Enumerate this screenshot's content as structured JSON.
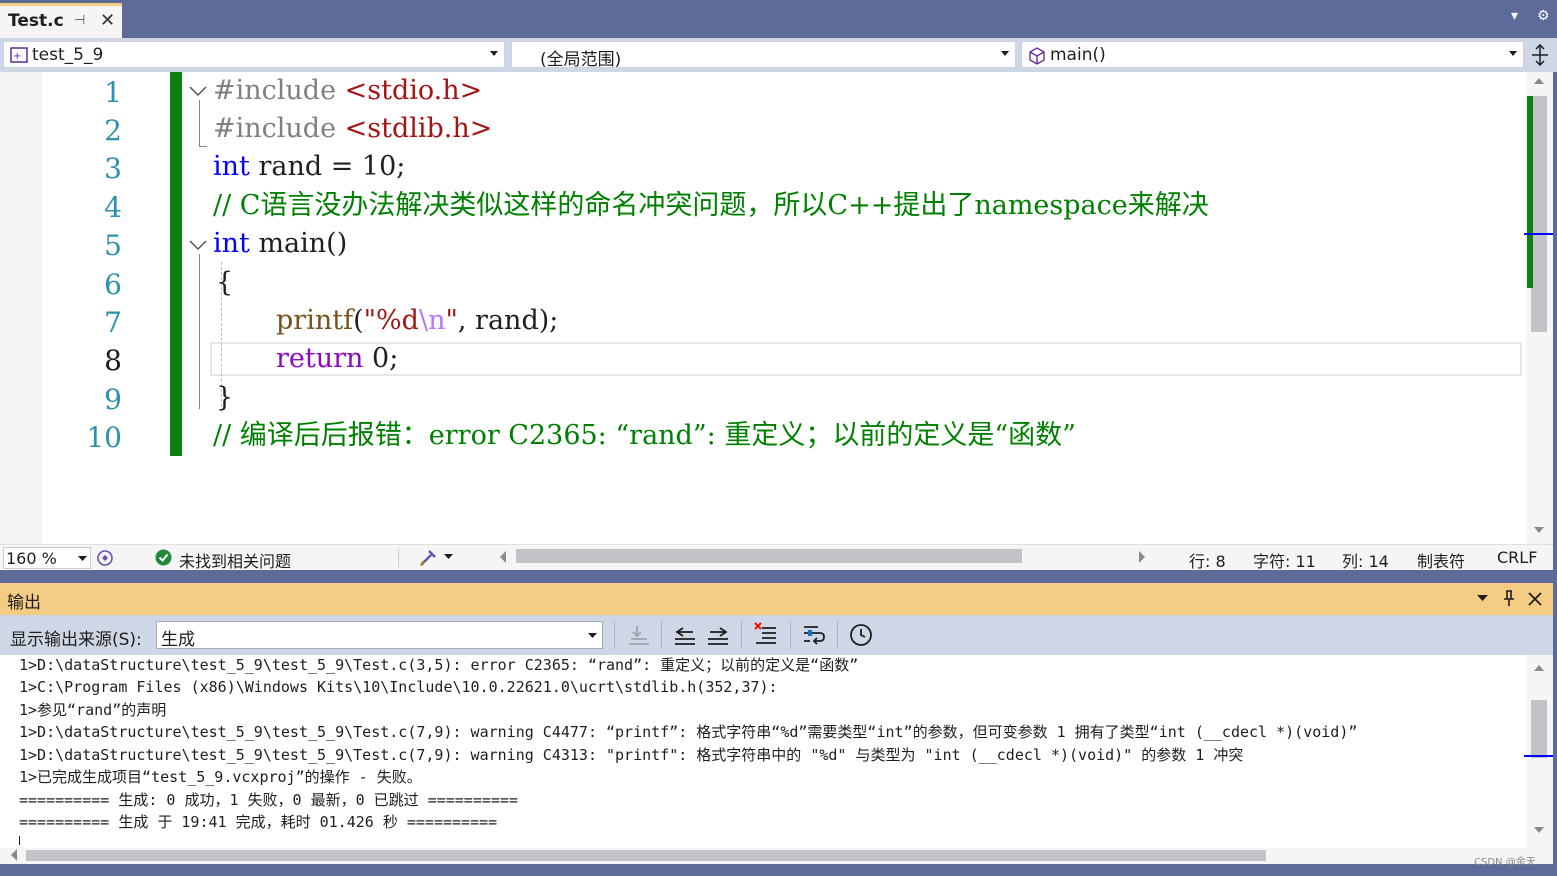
{
  "tab": {
    "name": "Test.c",
    "pin": "⊣",
    "close": "✕"
  },
  "window_icons": {
    "dropdown": "▾",
    "settings": "⚙"
  },
  "navbar": {
    "project": "test_5_9",
    "scope": "(全局范围)",
    "member": "main()"
  },
  "editor": {
    "line_numbers": [
      "1",
      "2",
      "3",
      "4",
      "5",
      "6",
      "7",
      "8",
      "9",
      "10"
    ],
    "current_line": 8,
    "lines": {
      "l1": {
        "pp": "#include ",
        "inc": "<stdio.h>"
      },
      "l2": {
        "pp": "#include ",
        "inc": "<stdlib.h>"
      },
      "l3": {
        "kw": "int",
        "rest": " rand = 10;"
      },
      "l4": {
        "comment": "// C语言没办法解决类似这样的命名冲突问题，所以C++提出了namespace来解决"
      },
      "l5": {
        "kw": "int",
        "rest": " main()"
      },
      "l6": {
        "text": "{"
      },
      "l7": {
        "fn": "printf",
        "open": "(",
        "str1": "\"%d",
        "esc": "\\n",
        "str2": "\"",
        "rest": ", rand);"
      },
      "l8": {
        "ctl": "return",
        "num": " 0",
        "rest": ";"
      },
      "l9": {
        "text": "}"
      },
      "l10": {
        "comment": "// 编译后后报错：error C2365: “rand”: 重定义；以前的定义是“函数”"
      }
    }
  },
  "statusbar": {
    "zoom": "160 %",
    "issues": "未找到相关问题",
    "line": "行: 8",
    "char": "字符: 11",
    "col": "列: 14",
    "tabs": "制表符",
    "eol": "CRLF"
  },
  "output": {
    "title": "输出",
    "source_label": "显示输出来源(S):",
    "source_value": "生成",
    "lines": [
      "1>D:\\dataStructure\\test_5_9\\test_5_9\\Test.c(3,5): error C2365: “rand”: 重定义；以前的定义是“函数”",
      "1>C:\\Program Files (x86)\\Windows Kits\\10\\Include\\10.0.22621.0\\ucrt\\stdlib.h(352,37):",
      "1>参见“rand”的声明",
      "1>D:\\dataStructure\\test_5_9\\test_5_9\\Test.c(7,9): warning C4477: “printf”: 格式字符串“%d”需要类型“int”的参数，但可变参数 1 拥有了类型“int (__cdecl *)(void)”",
      "1>D:\\dataStructure\\test_5_9\\test_5_9\\Test.c(7,9): warning C4313: \"printf\": 格式字符串中的 \"%d\" 与类型为 \"int (__cdecl *)(void)\" 的参数 1 冲突",
      "1>已完成生成项目“test_5_9.vcxproj”的操作 - 失败。",
      "========== 生成: 0 成功，1 失败，0 最新，0 已跳过 ==========",
      "========== 生成 于 19:41 完成，耗时 01.426 秒 =========="
    ]
  },
  "watermark": "CSDN @余天",
  "colors": {
    "accent": "#f5cc84",
    "chrome": "#5d6b99",
    "gutter_changed": "#108010"
  }
}
